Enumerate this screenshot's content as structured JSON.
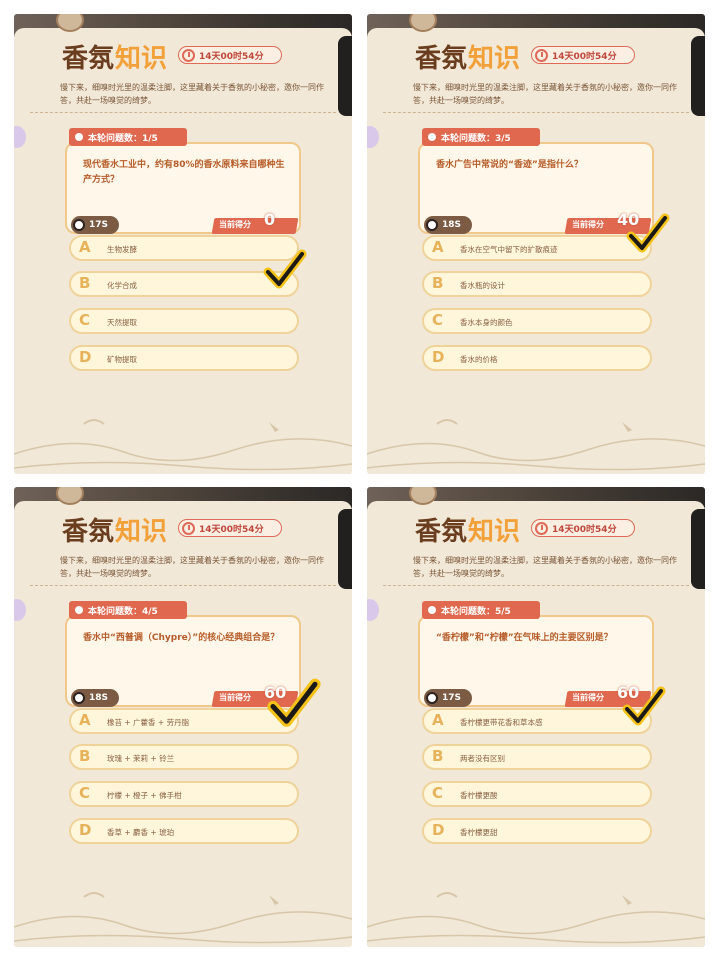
{
  "app": {
    "title_main": "香氛",
    "title_accent": "知识",
    "countdown": "14天00时54分",
    "intro": "慢下来，细嗅时光里的温柔注脚，这里藏着关于香氛的小秘密，邀你一同作答，共赴一场嗅觉的绮梦。",
    "score_label": "当前得分"
  },
  "panels": [
    {
      "round": "本轮问题数：1/5",
      "question": "现代香水工业中，约有80%的香水原料来自哪种生产方式？",
      "time": "17S",
      "score": "0",
      "options": [
        {
          "letter": "A",
          "text": "生物发酵"
        },
        {
          "letter": "B",
          "text": "化学合成"
        },
        {
          "letter": "C",
          "text": "天然提取"
        },
        {
          "letter": "D",
          "text": "矿物提取"
        }
      ],
      "checked_option": "B"
    },
    {
      "round": "本轮问题数：3/5",
      "question": "香水广告中常说的“香迹”是指什么？",
      "time": "18S",
      "score": "40",
      "options": [
        {
          "letter": "A",
          "text": "香水在空气中留下的扩散痕迹"
        },
        {
          "letter": "B",
          "text": "香水瓶的设计"
        },
        {
          "letter": "C",
          "text": "香水本身的颜色"
        },
        {
          "letter": "D",
          "text": "香水的价格"
        }
      ],
      "checked_option": "A"
    },
    {
      "round": "本轮问题数：4/5",
      "question": "香水中“西普调（Chypre）”的核心经典组合是？",
      "time": "18S",
      "score": "60",
      "options": [
        {
          "letter": "A",
          "text": "橡苔 + 广藿香 + 劳丹脂"
        },
        {
          "letter": "B",
          "text": "玫瑰 + 茉莉 + 铃兰"
        },
        {
          "letter": "C",
          "text": "柠檬 + 橙子 + 佛手柑"
        },
        {
          "letter": "D",
          "text": "香草 + 麝香 + 琥珀"
        }
      ],
      "checked_option": "A"
    },
    {
      "round": "本轮问题数：5/5",
      "question": "“香柠檬”和“柠檬”在气味上的主要区别是？",
      "time": "17S",
      "score": "60",
      "options": [
        {
          "letter": "A",
          "text": "香柠檬更带花香和草本感"
        },
        {
          "letter": "B",
          "text": "两者没有区别"
        },
        {
          "letter": "C",
          "text": "香柠檬更酸"
        },
        {
          "letter": "D",
          "text": "香柠檬更甜"
        }
      ],
      "checked_option": "A"
    }
  ]
}
